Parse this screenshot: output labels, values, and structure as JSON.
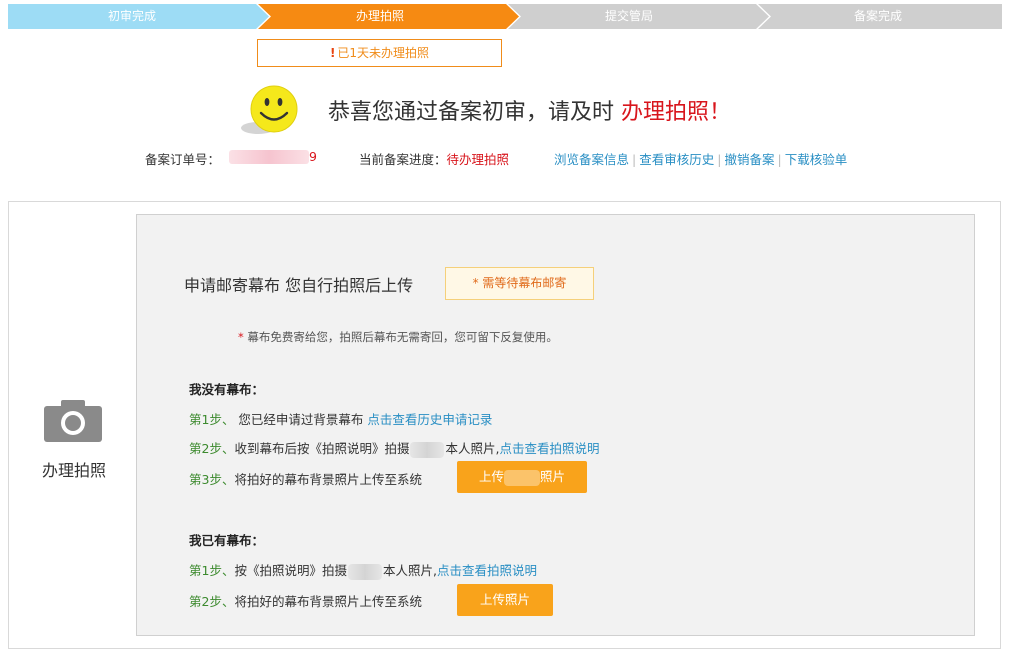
{
  "colors": {
    "step_done": "#9ddcf5",
    "step_active": "#f68a12",
    "step_todo": "#cfcfcf",
    "accent_red": "#d8151c",
    "link_blue": "#2a8fc4",
    "step_green": "#3c8a2e",
    "button_orange": "#f9a31b"
  },
  "steps": [
    {
      "label": "初审完成",
      "state": "done"
    },
    {
      "label": "办理拍照",
      "state": "active"
    },
    {
      "label": "提交管局",
      "state": "todo"
    },
    {
      "label": "备案完成",
      "state": "todo"
    }
  ],
  "notice": {
    "icon": "exclamation-icon",
    "text": "已1天未办理拍照"
  },
  "congrats": {
    "icon": "smiley-face-icon",
    "text_main": "恭喜您通过备案初审，请及时 ",
    "text_highlight": "办理拍照！"
  },
  "order": {
    "label": "备案订单号：",
    "value_tail": "9"
  },
  "progress": {
    "label": "当前备案进度：",
    "value": "待办理拍照"
  },
  "links": [
    "浏览备案信息",
    "查看审核历史",
    "撤销备案",
    "下载核验单"
  ],
  "side": {
    "icon": "camera-icon",
    "label": "办理拍照"
  },
  "option": {
    "title": "申请邮寄幕布 您自行拍照后上传",
    "badge": "* 需等待幕布邮寄",
    "note_star": "* ",
    "note": "幕布免费寄给您，拍照后幕布无需寄回，您可留下反复使用。"
  },
  "no_screen": {
    "title": "我没有幕布：",
    "step1_num": "第1步、",
    "step1_text": " 您已经申请过背景幕布  ",
    "step1_link": "点击查看历史申请记录",
    "step2_num": "第2步、",
    "step2_text_a": "收到幕布后按《拍照说明》拍摄",
    "step2_text_b": "本人照片,",
    "step2_link": "点击查看拍照说明",
    "step3_num": "第3步、",
    "step3_text": "将拍好的幕布背景照片上传至系统",
    "button_a": "上传",
    "button_b": "照片"
  },
  "have_screen": {
    "title": "我已有幕布：",
    "step1_num": "第1步、",
    "step1_text_a": "按《拍照说明》拍摄",
    "step1_text_b": "本人照片,",
    "step1_link": "点击查看拍照说明",
    "step2_num": "第2步、",
    "step2_text": "将拍好的幕布背景照片上传至系统",
    "button": "上传照片"
  }
}
